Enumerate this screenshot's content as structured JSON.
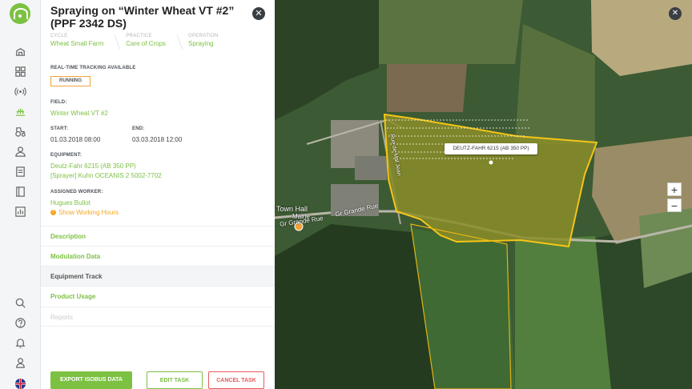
{
  "panel": {
    "title": "Spraying on “Winter Wheat VT #2” (PPF 2342 DS)",
    "close_icon": "✕",
    "breadcrumb": [
      {
        "key": "CYCLE",
        "value": "Wheat Small Farm"
      },
      {
        "key": "PRACTICE",
        "value": "Care of Crops"
      },
      {
        "key": "OPERATION",
        "value": "Spraying"
      }
    ],
    "tracking_label": "REAL-TIME TRACKING AVAILABLE",
    "status_badge": "RUNNING",
    "field_label": "FIELD:",
    "field_value": "Winter Wheat VT #2",
    "start_label": "START:",
    "start_value": "01.03.2018 08:00",
    "end_label": "END:",
    "end_value": "03.03.2018 12:00",
    "equipment_label": "EQUIPMENT:",
    "equipment": [
      "Deutz-Fahr 6215 (AB 350 PP)",
      "[Sprayer] Kuhn OCEANIS 2 5002-7702"
    ],
    "worker_label": "ASSIGNED WORKER:",
    "worker_value": "Hugues Bullot",
    "warn_icon": "!",
    "working_hours_link": "Show Working Hours",
    "sections": [
      "Description",
      "Modulation Data",
      "Equipment Track",
      "Product Usage",
      "Reports"
    ],
    "buttons": {
      "export": "EXPORT ISOBUS DATA",
      "edit": "EDIT TASK",
      "cancel": "CANCEL TASK"
    }
  },
  "map": {
    "close_icon": "✕",
    "zoom_in": "+",
    "zoom_out": "−",
    "equipment_tooltip": "DEUTZ-FAHR 6215 (AB 350 PP)",
    "town_hall": "Town Hall",
    "mairie": "Mairie",
    "road_1": "Gr Grande Rue",
    "road_2": "Gr Grande Rue",
    "road_3": "Rue de Mal Jean"
  },
  "colors": {
    "accent": "#7cc142",
    "field_outline": "#f5c518",
    "danger": "#e85a5a",
    "running": "#f2a23a"
  }
}
